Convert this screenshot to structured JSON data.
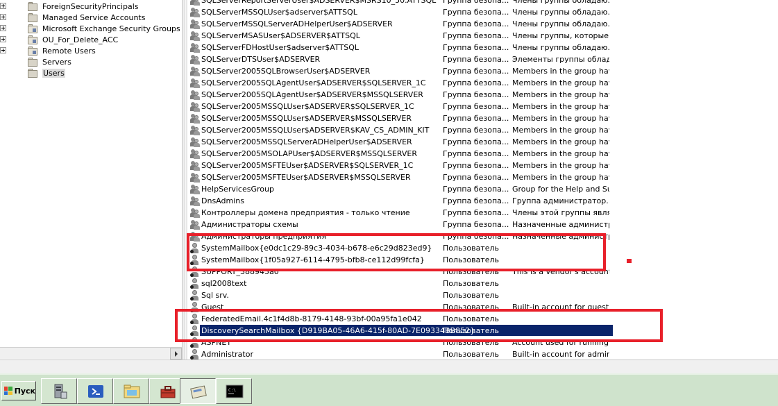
{
  "tree": {
    "items": [
      {
        "label": "ForeignSecurityPrincipals",
        "expandable": true,
        "kind": "container"
      },
      {
        "label": "Managed Service Accounts",
        "expandable": true,
        "kind": "container"
      },
      {
        "label": "Microsoft Exchange Security Groups",
        "expandable": true,
        "kind": "ou"
      },
      {
        "label": "OU_For_Delete_ACC",
        "expandable": true,
        "kind": "ou"
      },
      {
        "label": "Remote Users",
        "expandable": true,
        "kind": "ou"
      },
      {
        "label": "Servers",
        "expandable": false,
        "kind": "container"
      },
      {
        "label": "Users",
        "expandable": false,
        "kind": "container",
        "selected": true
      }
    ]
  },
  "list": {
    "rows": [
      {
        "icon": "group-icon",
        "name": "SQLServerReportServerUser$ADSERVER$MSRS10_50.ATTSQL",
        "type": "Группа безопа...",
        "desc": "Члены группы обладаю..."
      },
      {
        "icon": "group-icon",
        "name": "SQLServerMSSQLUser$adserver$ATTSQL",
        "type": "Группа безопа...",
        "desc": "Члены группы обладаю..."
      },
      {
        "icon": "group-icon",
        "name": "SQLServerMSSQLServerADHelperUser$ADSERVER",
        "type": "Группа безопа...",
        "desc": "Члены группы обладаю..."
      },
      {
        "icon": "group-icon",
        "name": "SQLServerMSASUser$ADSERVER$ATTSQL",
        "type": "Группа безопа...",
        "desc": "Члены группы, которые..."
      },
      {
        "icon": "group-icon",
        "name": "SQLServerFDHostUser$adserver$ATTSQL",
        "type": "Группа безопа...",
        "desc": "Члены группы обладаю..."
      },
      {
        "icon": "group-icon",
        "name": "SQLServerDTSUser$ADSERVER",
        "type": "Группа безопа...",
        "desc": "Элементы группы облад..."
      },
      {
        "icon": "group-icon",
        "name": "SQLServer2005SQLBrowserUser$ADSERVER",
        "type": "Группа безопа...",
        "desc": "Members in the group hav..."
      },
      {
        "icon": "group-icon",
        "name": "SQLServer2005SQLAgentUser$ADSERVER$SQLSERVER_1C",
        "type": "Группа безопа...",
        "desc": "Members in the group hav..."
      },
      {
        "icon": "group-icon",
        "name": "SQLServer2005SQLAgentUser$ADSERVER$MSSQLSERVER",
        "type": "Группа безопа...",
        "desc": "Members in the group hav..."
      },
      {
        "icon": "group-icon",
        "name": "SQLServer2005MSSQLUser$ADSERVER$SQLSERVER_1C",
        "type": "Группа безопа...",
        "desc": "Members in the group hav..."
      },
      {
        "icon": "group-icon",
        "name": "SQLServer2005MSSQLUser$ADSERVER$MSSQLSERVER",
        "type": "Группа безопа...",
        "desc": "Members in the group hav..."
      },
      {
        "icon": "group-icon",
        "name": "SQLServer2005MSSQLUser$ADSERVER$KAV_CS_ADMIN_KIT",
        "type": "Группа безопа...",
        "desc": "Members in the group hav..."
      },
      {
        "icon": "group-icon",
        "name": "SQLServer2005MSSQLServerADHelperUser$ADSERVER",
        "type": "Группа безопа...",
        "desc": "Members in the group hav..."
      },
      {
        "icon": "group-icon",
        "name": "SQLServer2005MSOLAPUser$ADSERVER$MSSQLSERVER",
        "type": "Группа безопа...",
        "desc": "Members in the group hav..."
      },
      {
        "icon": "group-icon",
        "name": "SQLServer2005MSFTEUser$ADSERVER$SQLSERVER_1C",
        "type": "Группа безопа...",
        "desc": "Members in the group hav..."
      },
      {
        "icon": "group-icon",
        "name": "SQLServer2005MSFTEUser$ADSERVER$MSSQLSERVER",
        "type": "Группа безопа...",
        "desc": "Members in the group hav..."
      },
      {
        "icon": "group-icon",
        "name": "HelpServicesGroup",
        "type": "Группа безопа...",
        "desc": "Group for the Help and Su..."
      },
      {
        "icon": "group-icon",
        "name": "DnsAdmins",
        "type": "Группа безопа...",
        "desc": "Группа администратор..."
      },
      {
        "icon": "group-icon",
        "name": "Контроллеры домена предприятия - только чтение",
        "type": "Группа безопа...",
        "desc": "Члены этой группы явля..."
      },
      {
        "icon": "group-icon",
        "name": "Администраторы схемы",
        "type": "Группа безопа...",
        "desc": "Назначенные администр..."
      },
      {
        "icon": "group-icon",
        "name": "Администраторы предприятия",
        "type": "Группа безопа...",
        "desc": "Назначенные администр..."
      },
      {
        "icon": "user-icon",
        "name": "SystemMailbox{e0dc1c29-89c3-4034-b678-e6c29d823ed9}",
        "type": "Пользователь",
        "desc": ""
      },
      {
        "icon": "user-icon",
        "name": "SystemMailbox{1f05a927-6114-4795-bfb8-ce112d99fcfa}",
        "type": "Пользователь",
        "desc": ""
      },
      {
        "icon": "user-icon",
        "name": "SUPPORT_388945a0",
        "type": "Пользователь",
        "desc": "This is a vendor's account f..."
      },
      {
        "icon": "user-icon",
        "name": "sql2008text",
        "type": "Пользователь",
        "desc": ""
      },
      {
        "icon": "user-icon",
        "name": "Sql srv.",
        "type": "Пользователь",
        "desc": ""
      },
      {
        "icon": "user-icon",
        "name": "Guest",
        "type": "Пользователь",
        "desc": "Built-in account for guest ..."
      },
      {
        "icon": "user-icon",
        "name": "FederatedEmail.4c1f4d8b-8179-4148-93bf-00a95fa1e042",
        "type": "Пользователь",
        "desc": ""
      },
      {
        "icon": "user-icon",
        "name": "DiscoverySearchMailbox {D919BA05-46A6-415f-80AD-7E09334BB852}",
        "type": "Пользователь",
        "desc": "",
        "selected": true
      },
      {
        "icon": "user-icon",
        "name": "ASPNET",
        "type": "Пользователь",
        "desc": "Account used for running th..."
      },
      {
        "icon": "user-icon",
        "name": "Administrator",
        "type": "Пользователь",
        "desc": "Built-in account for admini..."
      }
    ]
  },
  "taskbar": {
    "start_label": "Пуск",
    "buttons": [
      {
        "icon": "server-manager-icon"
      },
      {
        "icon": "powershell-icon"
      },
      {
        "icon": "explorer-icon"
      },
      {
        "icon": "app-window-icon"
      },
      {
        "icon": "toolbox-icon"
      },
      {
        "icon": "ad-users-icon",
        "active": true
      },
      {
        "icon": "command-prompt-icon"
      }
    ]
  },
  "colors": {
    "selection": "#0a246a",
    "annotation": "#e8202a",
    "taskbar": "#cfe3cc"
  }
}
